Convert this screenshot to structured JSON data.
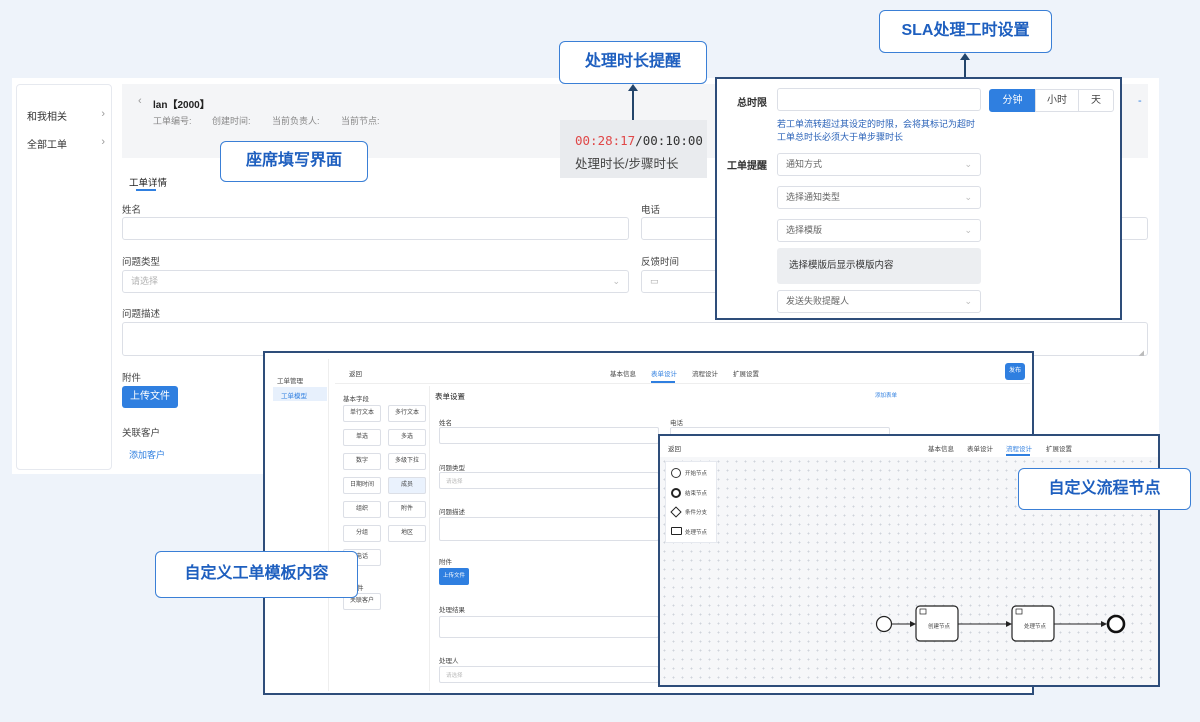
{
  "sidebar": {
    "items": [
      {
        "label": "和我相关"
      },
      {
        "label": "全部工单"
      }
    ]
  },
  "ticket": {
    "title": "lan【2000】",
    "meta": [
      "工单编号:",
      "创建时间:",
      "当前负责人:",
      "当前节点:"
    ],
    "tab": "工单详情",
    "fields": {
      "name": "姓名",
      "phone": "电话",
      "issue_type": "问题类型",
      "issue_type_placeholder": "请选择",
      "feedback_time": "反馈时间",
      "description": "问题描述",
      "attachment": "附件",
      "upload_button": "上传文件",
      "related_customer": "关联客户",
      "add_customer": "添加客户"
    }
  },
  "callouts": {
    "seat_form": "座席填写界面",
    "duration_reminder": "处理时长提醒",
    "sla_setting": "SLA处理工时设置",
    "custom_template": "自定义工单模板内容",
    "custom_flow": "自定义流程节点"
  },
  "timer": {
    "elapsed": "00:28:17",
    "separator": "/",
    "limit": "00:10:00",
    "caption": "处理时长/步骤时长"
  },
  "sla": {
    "total_label": "总时限",
    "units": [
      "分钟",
      "小时",
      "天"
    ],
    "active_unit": "分钟",
    "hint": "若工单流转超过其设定的时限，会将其标记为超时 工单总时长必须大于单步骤时长",
    "reminder_label": "工单提醒",
    "notify_method": "通知方式",
    "notify_type": "选择通知类型",
    "template": "选择模版",
    "template_preview": "选择模版后显示模版内容",
    "fail_reminder": "发送失败提醒人",
    "dash": "-"
  },
  "template_window": {
    "sidebar": [
      "工单管理",
      "工单模型"
    ],
    "back": "返回",
    "tabs": [
      "基本信息",
      "表单设计",
      "流程设计",
      "扩展设置"
    ],
    "active_tab": "表单设计",
    "publish": "发布",
    "basic_fields_title": "基本字段",
    "chips": [
      "单行文本",
      "多行文本",
      "单选",
      "多选",
      "数字",
      "多级下拉",
      "日期时间",
      "成员",
      "组织",
      "附件",
      "分组",
      "地区",
      "电话"
    ],
    "extra_chip": "关联客户",
    "partial_label": "件",
    "form_settings": "表单设置",
    "form_settings_link": "添加表单",
    "form": {
      "name": "姓名",
      "phone": "电话",
      "issue_type": "问题类型",
      "issue_type_placeholder": "请选择",
      "description": "问题描述",
      "attachment": "附件",
      "upload": "上传文件",
      "result": "处理结果",
      "handler": "处理人",
      "handler_placeholder": "请选择"
    }
  },
  "flow_window": {
    "back": "返回",
    "tabs": [
      "基本信息",
      "表单设计",
      "流程设计",
      "扩展设置"
    ],
    "active_tab": "流程设计",
    "palette": [
      "开始节点",
      "结束节点",
      "条件分支",
      "处理节点"
    ],
    "nodes": [
      "创建节点",
      "处理节点"
    ]
  },
  "colors": {
    "accent": "#2f7fe0",
    "callout_border": "#3a7fd6",
    "frame": "#2e4d7a",
    "timer_red": "#e04848"
  }
}
